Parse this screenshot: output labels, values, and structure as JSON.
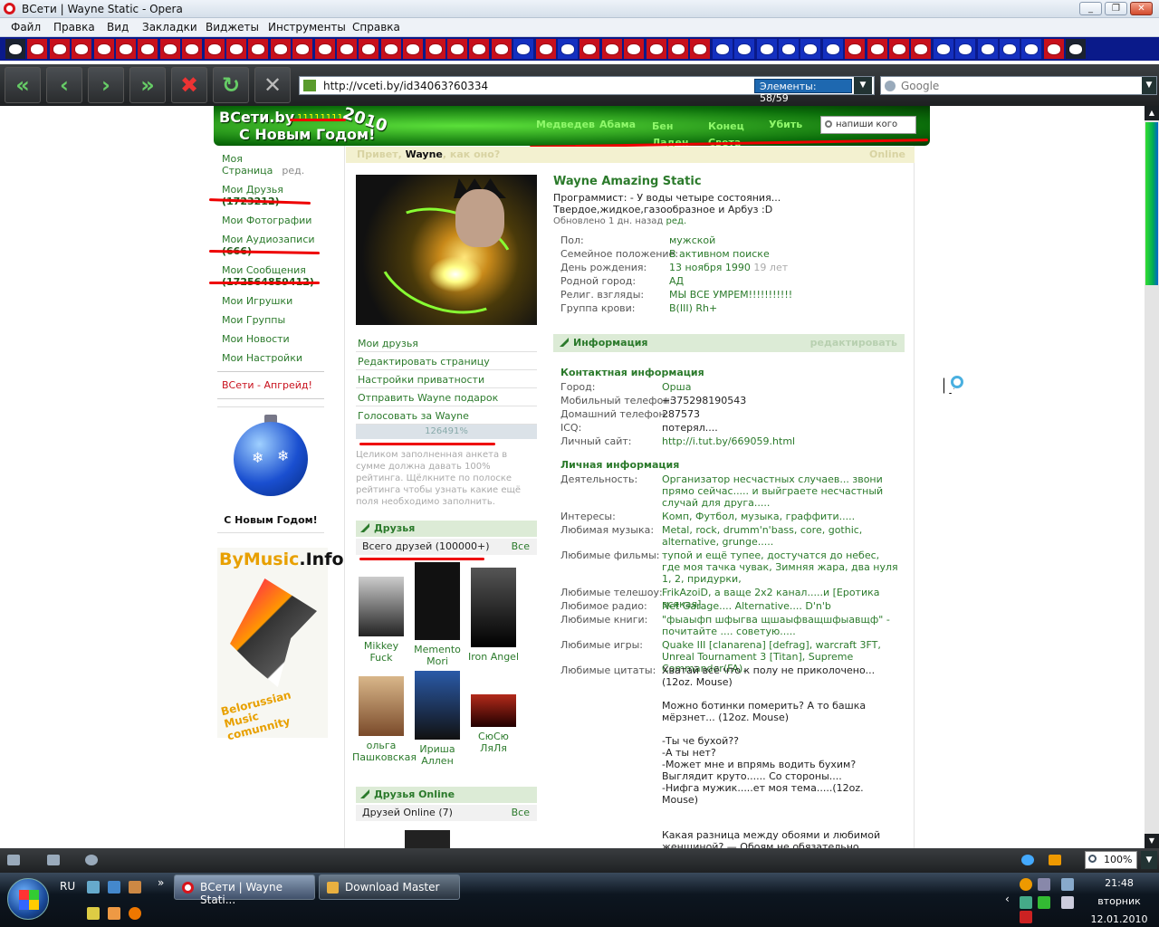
{
  "window": {
    "title": "ВСети | Wayne Static - Opera"
  },
  "menu": [
    "Файл",
    "Правка",
    "Вид",
    "Закладки",
    "Виджеты",
    "Инструменты",
    "Справка"
  ],
  "address": {
    "url": "http://vceti.by/id34063?60334",
    "elements_label": "Элементы:",
    "elements_count": "58/59"
  },
  "search": {
    "placeholder": "Google"
  },
  "site": {
    "logo_line1": "ВСети.by",
    "logo_line2": "С Новым Годом!",
    "logo_year": "2010",
    "logo_ones": "11111111",
    "nav": [
      "Медведев",
      "Абама",
      "Бен Ладен",
      "Конец Света",
      "Убить"
    ],
    "search_placeholder": "напиши кого"
  },
  "greeting": {
    "hello": "Привет,",
    "name": "Wayne",
    "tail": ", как оно?",
    "online": "Online"
  },
  "left_menu": {
    "my_page": "Моя Страница",
    "my_page_edit": "ред.",
    "friends": "Мои Друзья",
    "friends_count": "(1723212)",
    "photos": "Мои Фотографии",
    "audio": "Мои Аудиозаписи",
    "audio_count": "(666)",
    "messages": "Мои Сообщения",
    "messages_count": "(172564859412)",
    "games": "Мои Игрушки",
    "groups": "Мои Группы",
    "news": "Мои Новости",
    "settings": "Мои Настройки",
    "upgrade": "ВСети - Апгрейд!",
    "ball_caption": "С Новым Годом!",
    "bymusic_1": "ByMusic",
    "bymusic_2": ".Info",
    "bymusic_3": "Belorussian Music",
    "bymusic_4": "comunnity"
  },
  "actions": {
    "my_friends": "Мои друзья",
    "edit_page": "Редактировать страницу",
    "privacy": "Настройки приватности",
    "gift": "Отправить Wayne подарок",
    "vote": "Голосовать за Wayne",
    "rating": "126491%",
    "rating_note": "Целиком заполненная анкета в сумме должна давать 100% рейтинга. Щёлкните по полоске рейтинга чтобы узнать какие ещё поля необходимо заполнить."
  },
  "friends": {
    "title": "Друзья",
    "total": "Всего друзей (100000+)",
    "all": "Все",
    "list": [
      {
        "name": "Mikkey Fuck"
      },
      {
        "name": "Memento Mori"
      },
      {
        "name": "Iron Angel"
      },
      {
        "name": "ольга Пашковская"
      },
      {
        "name": "Ириша Аллен"
      },
      {
        "name": "СюСю ЛяЛя"
      }
    ]
  },
  "friends_online": {
    "title": "Друзья Online",
    "total": "Друзей Online (7)",
    "all": "Все"
  },
  "profile": {
    "name": "Wayne Amazing Static",
    "status": "Программист: - У воды четыре состояния... Твердое,жидкое,газообразное и Арбуз :D",
    "updated": "Обновлено 1 дн. назад",
    "updated_edit": "ред.",
    "fields": [
      {
        "k": "Пол:",
        "v": "мужской"
      },
      {
        "k": "Семейное положение:",
        "v": "В активном поиске"
      },
      {
        "k": "День рождения:",
        "v": "13 ноября 1990",
        "extra": "19 лет"
      },
      {
        "k": "Родной город:",
        "v": "АД"
      },
      {
        "k": "Религ. взгляды:",
        "v": "МЫ ВСЕ УМРЕМ!!!!!!!!!!!"
      },
      {
        "k": "Группа крови:",
        "v": "B(III) Rh+"
      }
    ],
    "info_title": "Информация",
    "info_edit": "редактировать",
    "contact_title": "Контактная информация",
    "contact": [
      {
        "k": "Город:",
        "v": "Орша"
      },
      {
        "k": "Мобильный телефон:",
        "v": "+375298190543"
      },
      {
        "k": "Домашний телефон:",
        "v": "287573"
      },
      {
        "k": "ICQ:",
        "v": "потерял...."
      },
      {
        "k": "Личный сайт:",
        "v": "http://i.tut.by/669059.html"
      }
    ],
    "personal_title": "Личная информация",
    "personal": [
      {
        "k": "Деятельность:",
        "v": "Организатор несчастных случаев... звони прямо сейчас..... и выйграете несчастный случай для друга....."
      },
      {
        "k": "Интересы:",
        "v": "Комп, Футбол, музыка, граффити....."
      },
      {
        "k": "Любимая музыка:",
        "v": "Metal, rock, drumm'n'bass, core, gothic, alternative, grunge....."
      },
      {
        "k": "Любимые фильмы:",
        "v": "тупой и ещё тупее, достучатся до небес, где моя тачка чувак, Зимняя жара, два нуля 1, 2, придурки,"
      },
      {
        "k": "Любимые телешоу:",
        "v": "FrikAzoiD, а ваще 2х2 канал.....и [Еротика всякая]"
      },
      {
        "k": "Любимое радио:",
        "v": "Net Garage.... Alternative.... D'n'b"
      },
      {
        "k": "Любимые книги:",
        "v": "\"фыаыфп шфыгва щшаыфващшфыавщф\" - почитайте .... советую....."
      },
      {
        "k": "Любимые игры:",
        "v": "Quake III [clanarena] [defrag], warcraft 3FT, Unreal Tournament 3 [Titan], Supreme Commander(FA)."
      },
      {
        "k": "Любимые цитаты:",
        "v": "Хватай всё что к полу не приколочено... (12oz. Mouse)\n\nМожно ботинки померить? А то башка мёрзнет... (12oz. Mouse)\n\n-Ты че бухой??\n-А ты нет?\n-Может мне и впрямь водить бухим?Выглядит круто...... Со стороны....\n-Нифга мужик.....ет моя тема.....(12oz. Mouse)\n\n\nКакая разница между обоями и любимой женщиной? — Обоям не обязательно говорить, что ты их любишь, перед"
      }
    ]
  },
  "statusbar": {
    "zoom": "100%"
  },
  "taskbar": {
    "lang": "RU",
    "tasks": [
      "ВСети | Wayne Stati...",
      "Download Master"
    ],
    "time": "21:48",
    "day": "вторник",
    "date": "12.01.2010"
  }
}
